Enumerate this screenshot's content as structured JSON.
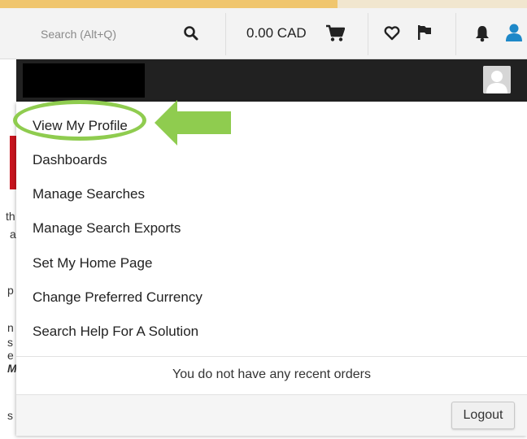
{
  "accent_colors": {
    "highlight": "#8fcc4f",
    "header_band": "#212121",
    "progress": "#f0c66e",
    "user_icon": "#1e88c8"
  },
  "top_progress": {
    "fill_fraction": 0.64
  },
  "search": {
    "placeholder": "Search (Alt+Q)",
    "icon": "search-icon"
  },
  "cart": {
    "total": "0.00 CAD",
    "icon": "cart-icon"
  },
  "toolbar_icons": [
    "heart-icon",
    "flag-icon",
    "bell-icon",
    "user-icon"
  ],
  "profile_menu": {
    "items": [
      {
        "label": "View My Profile"
      },
      {
        "label": "Dashboards"
      },
      {
        "label": "Manage Searches"
      },
      {
        "label": "Manage Search Exports"
      },
      {
        "label": "Set My Home Page"
      },
      {
        "label": "Change Preferred Currency"
      },
      {
        "label": "Search Help For A Solution"
      }
    ],
    "recent_orders_text": "You do not have any recent orders",
    "logout_label": "Logout"
  },
  "background_fragments": [
    "th",
    "a",
    "p",
    "n",
    "s",
    "e",
    "M",
    "s"
  ]
}
